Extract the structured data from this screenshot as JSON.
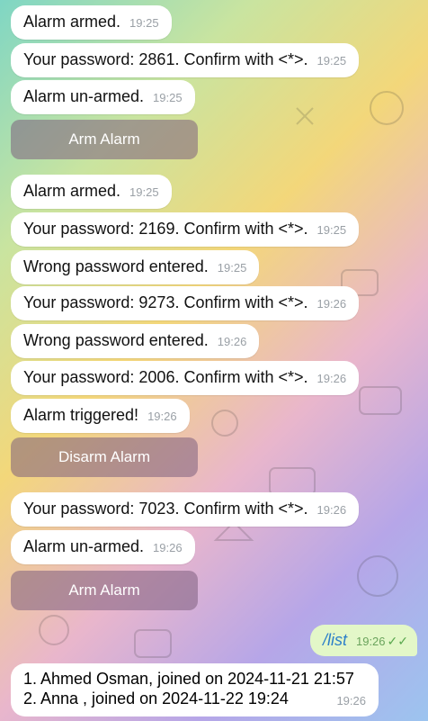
{
  "messages": [
    {
      "text": "Alarm armed.",
      "time": "19:25"
    },
    {
      "text": "Your password: 2861. Confirm with <*>.",
      "time": "19:25"
    },
    {
      "text": "Alarm un-armed.",
      "time": "19:25"
    },
    {
      "text": "Alarm armed.",
      "time": "19:25"
    },
    {
      "text": "Your password: 2169. Confirm with <*>.",
      "time": "19:25"
    },
    {
      "text": "Wrong password entered.",
      "time": "19:25"
    },
    {
      "text": "Your password: 9273. Confirm with <*>.",
      "time": "19:26"
    },
    {
      "text": "Wrong password entered.",
      "time": "19:26"
    },
    {
      "text": "Your password: 2006. Confirm with <*>.",
      "time": "19:26"
    },
    {
      "text": "Alarm triggered!",
      "time": "19:26"
    },
    {
      "text": "Your password: 7023. Confirm with <*>.",
      "time": "19:26"
    },
    {
      "text": "Alarm un-armed.",
      "time": "19:26"
    }
  ],
  "buttons": {
    "arm_1": "Arm Alarm",
    "disarm": "Disarm Alarm",
    "arm_2": "Arm Alarm"
  },
  "outgoing": {
    "text": "/list",
    "time": "19:26",
    "status_icon": "double-check-icon"
  },
  "list_message": {
    "lines": [
      "1. Ahmed Osman, joined on 2024-11-21 21:57",
      "2. Anna , joined on 2024-11-22 19:24"
    ],
    "time": "19:26"
  }
}
